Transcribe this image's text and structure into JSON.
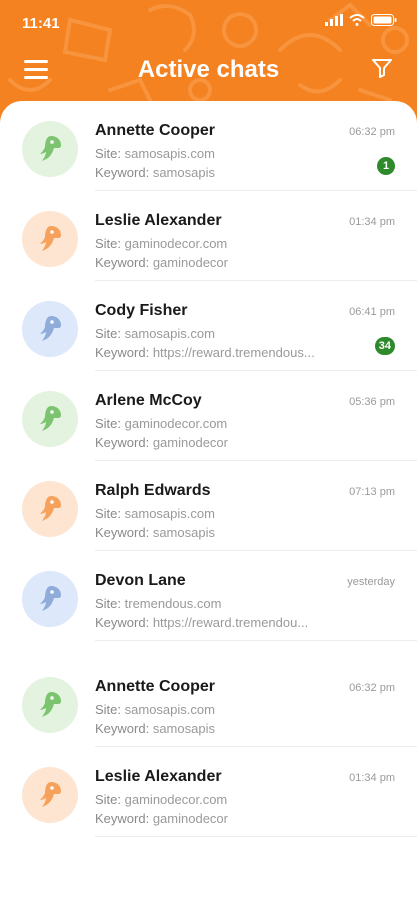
{
  "status_bar": {
    "time": "11:41"
  },
  "header": {
    "title": "Active chats"
  },
  "colors": {
    "accent": "#f58220",
    "badge": "#2f8a2c",
    "green_bg": "#e3f3df",
    "green_fg": "#7cc46f",
    "orange_bg": "#fde5d1",
    "orange_fg": "#f6a15c",
    "blue_bg": "#dde8fb",
    "blue_fg": "#90acd9"
  },
  "chats": [
    {
      "name": "Annette Cooper",
      "site_label": "Site:",
      "site": "samosapis.com",
      "keyword_label": "Keyword:",
      "keyword": "samosapis",
      "time": "06:32 pm",
      "badge": "1",
      "avatar_color": "green"
    },
    {
      "name": "Leslie Alexander",
      "site_label": "Site:",
      "site": "gaminodecor.com",
      "keyword_label": "Keyword:",
      "keyword": "gaminodecor",
      "time": "01:34 pm",
      "badge": "",
      "avatar_color": "orange"
    },
    {
      "name": "Cody Fisher",
      "site_label": "Site:",
      "site": "samosapis.com",
      "keyword_label": "Keyword:",
      "keyword": "https://reward.tremendous...",
      "time": "06:41 pm",
      "badge": "34",
      "avatar_color": "blue"
    },
    {
      "name": "Arlene McCoy",
      "site_label": "Site:",
      "site": "gaminodecor.com",
      "keyword_label": "Keyword:",
      "keyword": "gaminodecor",
      "time": "05:36 pm",
      "badge": "",
      "avatar_color": "green"
    },
    {
      "name": "Ralph Edwards",
      "site_label": "Site:",
      "site": "samosapis.com",
      "keyword_label": "Keyword:",
      "keyword": "samosapis",
      "time": "07:13 pm",
      "badge": "",
      "avatar_color": "orange"
    },
    {
      "name": "Devon Lane",
      "site_label": "Site:",
      "site": "tremendous.com",
      "keyword_label": "Keyword:",
      "keyword": "https://reward.tremendou...",
      "time": "yesterday",
      "badge": "",
      "avatar_color": "blue"
    },
    {
      "name": "Annette Cooper",
      "site_label": "Site:",
      "site": "samosapis.com",
      "keyword_label": "Keyword:",
      "keyword": "samosapis",
      "time": "06:32 pm",
      "badge": "",
      "avatar_color": "green"
    },
    {
      "name": "Leslie Alexander",
      "site_label": "Site:",
      "site": "gaminodecor.com",
      "keyword_label": "Keyword:",
      "keyword": "gaminodecor",
      "time": "01:34 pm",
      "badge": "",
      "avatar_color": "orange"
    }
  ]
}
